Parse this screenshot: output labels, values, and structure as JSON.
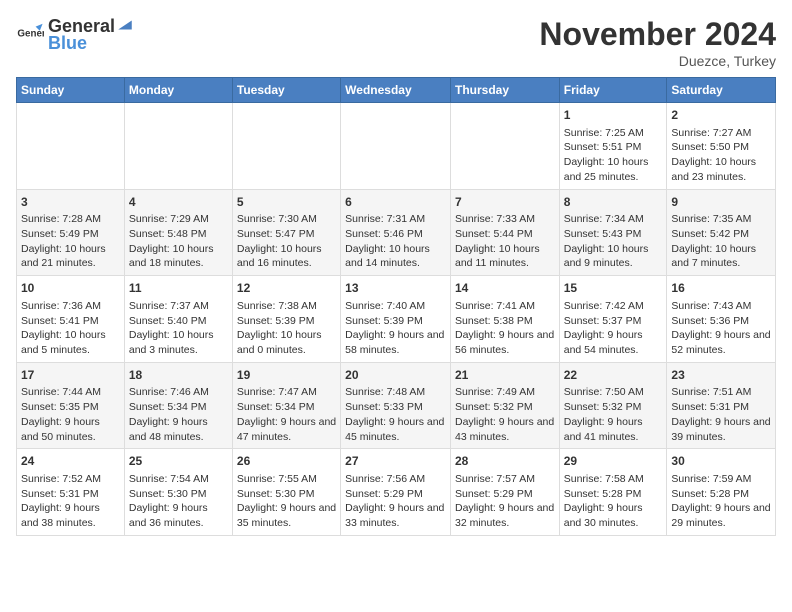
{
  "header": {
    "logo_general": "General",
    "logo_blue": "Blue",
    "month_title": "November 2024",
    "location": "Duezce, Turkey"
  },
  "days_of_week": [
    "Sunday",
    "Monday",
    "Tuesday",
    "Wednesday",
    "Thursday",
    "Friday",
    "Saturday"
  ],
  "weeks": [
    [
      {
        "day": "",
        "info": ""
      },
      {
        "day": "",
        "info": ""
      },
      {
        "day": "",
        "info": ""
      },
      {
        "day": "",
        "info": ""
      },
      {
        "day": "",
        "info": ""
      },
      {
        "day": "1",
        "info": "Sunrise: 7:25 AM\nSunset: 5:51 PM\nDaylight: 10 hours and 25 minutes."
      },
      {
        "day": "2",
        "info": "Sunrise: 7:27 AM\nSunset: 5:50 PM\nDaylight: 10 hours and 23 minutes."
      }
    ],
    [
      {
        "day": "3",
        "info": "Sunrise: 7:28 AM\nSunset: 5:49 PM\nDaylight: 10 hours and 21 minutes."
      },
      {
        "day": "4",
        "info": "Sunrise: 7:29 AM\nSunset: 5:48 PM\nDaylight: 10 hours and 18 minutes."
      },
      {
        "day": "5",
        "info": "Sunrise: 7:30 AM\nSunset: 5:47 PM\nDaylight: 10 hours and 16 minutes."
      },
      {
        "day": "6",
        "info": "Sunrise: 7:31 AM\nSunset: 5:46 PM\nDaylight: 10 hours and 14 minutes."
      },
      {
        "day": "7",
        "info": "Sunrise: 7:33 AM\nSunset: 5:44 PM\nDaylight: 10 hours and 11 minutes."
      },
      {
        "day": "8",
        "info": "Sunrise: 7:34 AM\nSunset: 5:43 PM\nDaylight: 10 hours and 9 minutes."
      },
      {
        "day": "9",
        "info": "Sunrise: 7:35 AM\nSunset: 5:42 PM\nDaylight: 10 hours and 7 minutes."
      }
    ],
    [
      {
        "day": "10",
        "info": "Sunrise: 7:36 AM\nSunset: 5:41 PM\nDaylight: 10 hours and 5 minutes."
      },
      {
        "day": "11",
        "info": "Sunrise: 7:37 AM\nSunset: 5:40 PM\nDaylight: 10 hours and 3 minutes."
      },
      {
        "day": "12",
        "info": "Sunrise: 7:38 AM\nSunset: 5:39 PM\nDaylight: 10 hours and 0 minutes."
      },
      {
        "day": "13",
        "info": "Sunrise: 7:40 AM\nSunset: 5:39 PM\nDaylight: 9 hours and 58 minutes."
      },
      {
        "day": "14",
        "info": "Sunrise: 7:41 AM\nSunset: 5:38 PM\nDaylight: 9 hours and 56 minutes."
      },
      {
        "day": "15",
        "info": "Sunrise: 7:42 AM\nSunset: 5:37 PM\nDaylight: 9 hours and 54 minutes."
      },
      {
        "day": "16",
        "info": "Sunrise: 7:43 AM\nSunset: 5:36 PM\nDaylight: 9 hours and 52 minutes."
      }
    ],
    [
      {
        "day": "17",
        "info": "Sunrise: 7:44 AM\nSunset: 5:35 PM\nDaylight: 9 hours and 50 minutes."
      },
      {
        "day": "18",
        "info": "Sunrise: 7:46 AM\nSunset: 5:34 PM\nDaylight: 9 hours and 48 minutes."
      },
      {
        "day": "19",
        "info": "Sunrise: 7:47 AM\nSunset: 5:34 PM\nDaylight: 9 hours and 47 minutes."
      },
      {
        "day": "20",
        "info": "Sunrise: 7:48 AM\nSunset: 5:33 PM\nDaylight: 9 hours and 45 minutes."
      },
      {
        "day": "21",
        "info": "Sunrise: 7:49 AM\nSunset: 5:32 PM\nDaylight: 9 hours and 43 minutes."
      },
      {
        "day": "22",
        "info": "Sunrise: 7:50 AM\nSunset: 5:32 PM\nDaylight: 9 hours and 41 minutes."
      },
      {
        "day": "23",
        "info": "Sunrise: 7:51 AM\nSunset: 5:31 PM\nDaylight: 9 hours and 39 minutes."
      }
    ],
    [
      {
        "day": "24",
        "info": "Sunrise: 7:52 AM\nSunset: 5:31 PM\nDaylight: 9 hours and 38 minutes."
      },
      {
        "day": "25",
        "info": "Sunrise: 7:54 AM\nSunset: 5:30 PM\nDaylight: 9 hours and 36 minutes."
      },
      {
        "day": "26",
        "info": "Sunrise: 7:55 AM\nSunset: 5:30 PM\nDaylight: 9 hours and 35 minutes."
      },
      {
        "day": "27",
        "info": "Sunrise: 7:56 AM\nSunset: 5:29 PM\nDaylight: 9 hours and 33 minutes."
      },
      {
        "day": "28",
        "info": "Sunrise: 7:57 AM\nSunset: 5:29 PM\nDaylight: 9 hours and 32 minutes."
      },
      {
        "day": "29",
        "info": "Sunrise: 7:58 AM\nSunset: 5:28 PM\nDaylight: 9 hours and 30 minutes."
      },
      {
        "day": "30",
        "info": "Sunrise: 7:59 AM\nSunset: 5:28 PM\nDaylight: 9 hours and 29 minutes."
      }
    ]
  ]
}
